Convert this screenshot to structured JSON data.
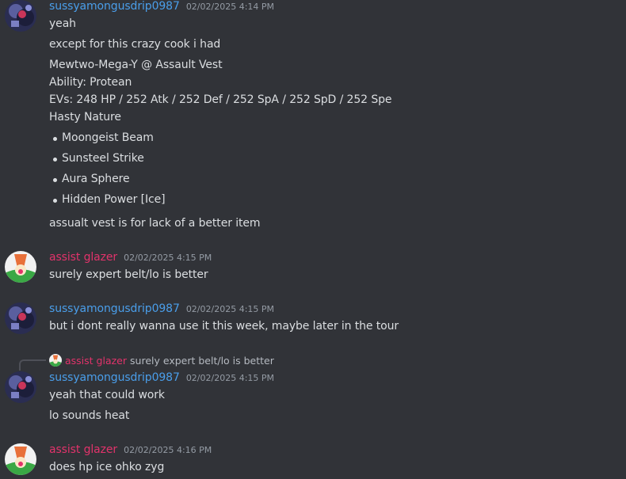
{
  "colors": {
    "background": "#313338",
    "user_sussy": "#4a9eea",
    "user_glazer": "#e2336b",
    "text": "#dbdee1",
    "timestamp": "#949ba4"
  },
  "messages": [
    {
      "author": "sussyamongusdrip0987",
      "timestamp": "02/02/2025 4:14 PM",
      "lines": [
        "yeah",
        "except for this crazy cook i had",
        "Mewtwo-Mega-Y @ Assault Vest",
        "Ability: Protean",
        "EVs: 248 HP / 252 Atk / 252 Def / 252 SpA / 252 SpD / 252 Spe",
        "Hasty Nature"
      ],
      "moves": [
        "Moongeist Beam",
        "Sunsteel Strike",
        "Aura Sphere",
        "Hidden Power [Ice]"
      ],
      "after": "assualt vest is for lack of a better item"
    },
    {
      "author": "assist glazer",
      "timestamp": "02/02/2025 4:15 PM",
      "lines": [
        "surely expert belt/lo is better"
      ]
    },
    {
      "author": "sussyamongusdrip0987",
      "timestamp": "02/02/2025 4:15 PM",
      "lines": [
        "but i dont really wanna use it this week, maybe later in the tour"
      ]
    },
    {
      "reply": {
        "author": "assist glazer",
        "text": "surely expert belt/lo is better"
      },
      "author": "sussyamongusdrip0987",
      "timestamp": "02/02/2025 4:15 PM",
      "lines": [
        "yeah that could work",
        "lo sounds heat"
      ]
    },
    {
      "author": "assist glazer",
      "timestamp": "02/02/2025 4:16 PM",
      "lines": [
        "does hp ice ohko zyg"
      ]
    }
  ]
}
